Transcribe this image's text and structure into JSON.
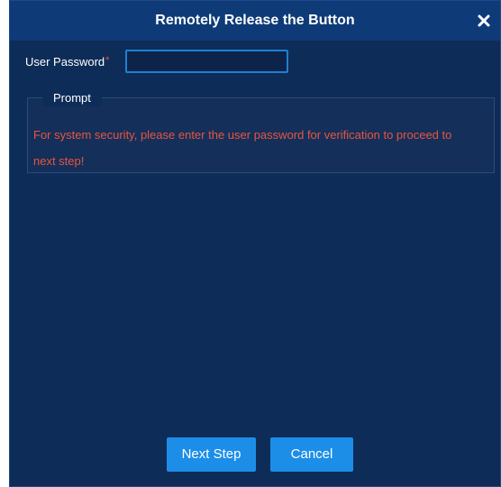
{
  "dialog": {
    "title": "Remotely Release the Button",
    "close_icon": "close-icon"
  },
  "form": {
    "password_label": "User Password",
    "required_mark": "*",
    "password_value": ""
  },
  "prompt": {
    "legend": "Prompt",
    "message": "For system security, please enter the user password for verification to proceed to next step!"
  },
  "buttons": {
    "next_label": "Next Step",
    "cancel_label": "Cancel"
  },
  "colors": {
    "dialog_bg": "#0e2c58",
    "titlebar_bg": "#0e3b78",
    "accent": "#1c8ee8",
    "warning_text": "#e8553e"
  }
}
